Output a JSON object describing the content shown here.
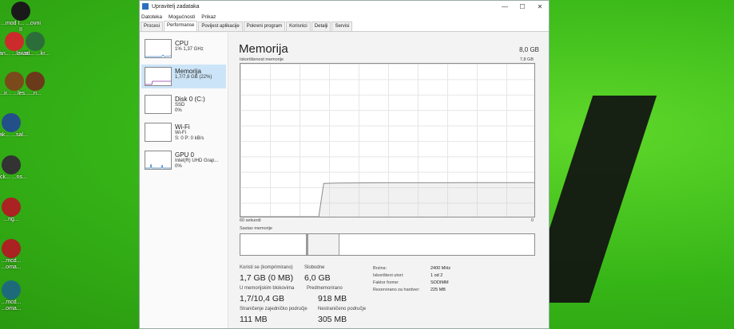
{
  "desktop": {
    "icons": [
      {
        "label": "...mod I... ...ovni II",
        "color": "#1a1a1a"
      },
      {
        "label": "...an... ...lawro...",
        "color": "#cc2b2b"
      },
      {
        "label": "...ir... ...les...",
        "color": "#7a4a1a"
      },
      {
        "label": "...al... ...kr...",
        "color": "#2c6e3a"
      },
      {
        "label": "...ak... ...sal...",
        "color": "#24508a"
      },
      {
        "label": "...ri...",
        "color": "#6b3a1a"
      },
      {
        "label": "...ng...",
        "color": "#aa2222"
      },
      {
        "label": "...ck... ...ns...",
        "color": "#333333"
      },
      {
        "label": "...mcd... ...oma...",
        "color": "#1d6b7a"
      }
    ]
  },
  "window": {
    "title": "Upravitelj zadataka",
    "controls": {
      "minimize": "—",
      "maximize": "☐",
      "close": "✕"
    },
    "menu": [
      "Datoteka",
      "Mogućnosti",
      "Prikaz"
    ],
    "tabs": [
      "Procesi",
      "Performanse",
      "Povijest aplikacije",
      "Pokreni program",
      "Korisnici",
      "Detalji",
      "Servisi"
    ],
    "active_tab": "Performanse"
  },
  "sidebar": {
    "items": [
      {
        "title": "CPU",
        "line1": "1% 1,37 GHz",
        "line2": ""
      },
      {
        "title": "Memorija",
        "line1": "1,7/7,8 GB (22%)",
        "line2": ""
      },
      {
        "title": "Disk 0 (C:)",
        "line1": "SSD",
        "line2": "0%"
      },
      {
        "title": "Wi-Fi",
        "line1": "Wi-Fi",
        "line2": "S: 0 P: 0 kB/s"
      },
      {
        "title": "GPU 0",
        "line1": "Intel(R) UHD Grap...",
        "line2": "0%"
      }
    ]
  },
  "main": {
    "title": "Memorija",
    "total": "8,0 GB",
    "graph_label": "Iskorištenost memorije",
    "graph_max": "7,8 GB",
    "x_left": "60 sekundi",
    "x_right": "0",
    "composition_label": "Sastav memorije",
    "usage": {
      "in_use_label": "Koristi se (komprimirano)",
      "in_use_value": "1,7 GB (0 MB)",
      "available_label": "Slobodne",
      "available_value": "6,0 GB",
      "committed_label": "U memorijskim blokovima",
      "committed_value": "1,7/10,4 GB",
      "cached_label": "Predmemorirano",
      "cached_value": "918 MB",
      "paged_label": "Straničenje zajedničko područje",
      "paged_value": "111 MB",
      "nonpaged_label": "Nestraničeno područje",
      "nonpaged_value": "305 MB"
    },
    "details": [
      {
        "key": "Brzina:",
        "value": "2400 MHz"
      },
      {
        "key": "Iskorišteni utori:",
        "value": "1 od 2"
      },
      {
        "key": "Faktor forme:",
        "value": "SODIMM"
      },
      {
        "key": "Rezervirano za hardver:",
        "value": "225 MB"
      }
    ]
  },
  "chart_data": {
    "type": "line",
    "ylabel": "Iskorištenost memorije",
    "xlabel": "",
    "x_range": [
      60,
      0
    ],
    "ylim": [
      0,
      7.8
    ],
    "series": [
      {
        "values_seconds_ago": [
          60,
          50,
          44,
          43,
          40,
          30,
          20,
          10,
          0
        ],
        "values_gb": [
          0,
          0,
          0,
          1.7,
          1.72,
          1.73,
          1.73,
          1.74,
          1.74
        ]
      }
    ]
  },
  "colors": {
    "desktop": "#3fbf1c",
    "selection": "#cce4f7",
    "graph_line": "#8a8a8a",
    "graph_grid": "#e6e6e6"
  }
}
